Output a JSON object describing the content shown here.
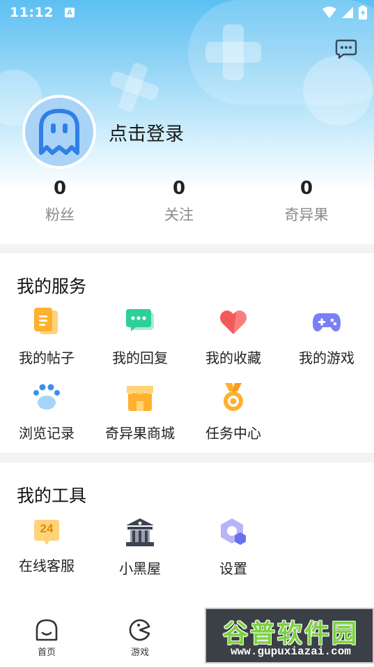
{
  "status_bar": {
    "time": "11:12",
    "notification_glyph": "A"
  },
  "profile": {
    "login_prompt": "点击登录"
  },
  "stats": [
    {
      "value": "0",
      "label": "粉丝"
    },
    {
      "value": "0",
      "label": "关注"
    },
    {
      "value": "0",
      "label": "奇异果"
    }
  ],
  "services": {
    "title": "我的服务",
    "items": [
      {
        "label": "我的帖子",
        "icon": "post-icon"
      },
      {
        "label": "我的回复",
        "icon": "reply-icon"
      },
      {
        "label": "我的收藏",
        "icon": "heart-icon"
      },
      {
        "label": "我的游戏",
        "icon": "gamepad-icon"
      },
      {
        "label": "浏览记录",
        "icon": "paw-icon"
      },
      {
        "label": "奇异果商城",
        "icon": "shop-icon"
      },
      {
        "label": "任务中心",
        "icon": "medal-icon"
      }
    ]
  },
  "tools": {
    "title": "我的工具",
    "items": [
      {
        "label": "在线客服",
        "icon": "service-24-icon",
        "badge": "24"
      },
      {
        "label": "小黑屋",
        "icon": "building-icon"
      },
      {
        "label": "设置",
        "icon": "settings-icon"
      }
    ]
  },
  "bottom_nav": [
    {
      "label": "首页",
      "icon": "home-icon"
    },
    {
      "label": "游戏",
      "icon": "game-icon"
    }
  ],
  "watermark": {
    "title": "谷普软件园",
    "url": "www.gupuxiazai.com"
  },
  "colors": {
    "header_top": "#5cc0f2",
    "avatar_bg": "#a9d3f7",
    "accent_blue": "#3b8ff0"
  }
}
